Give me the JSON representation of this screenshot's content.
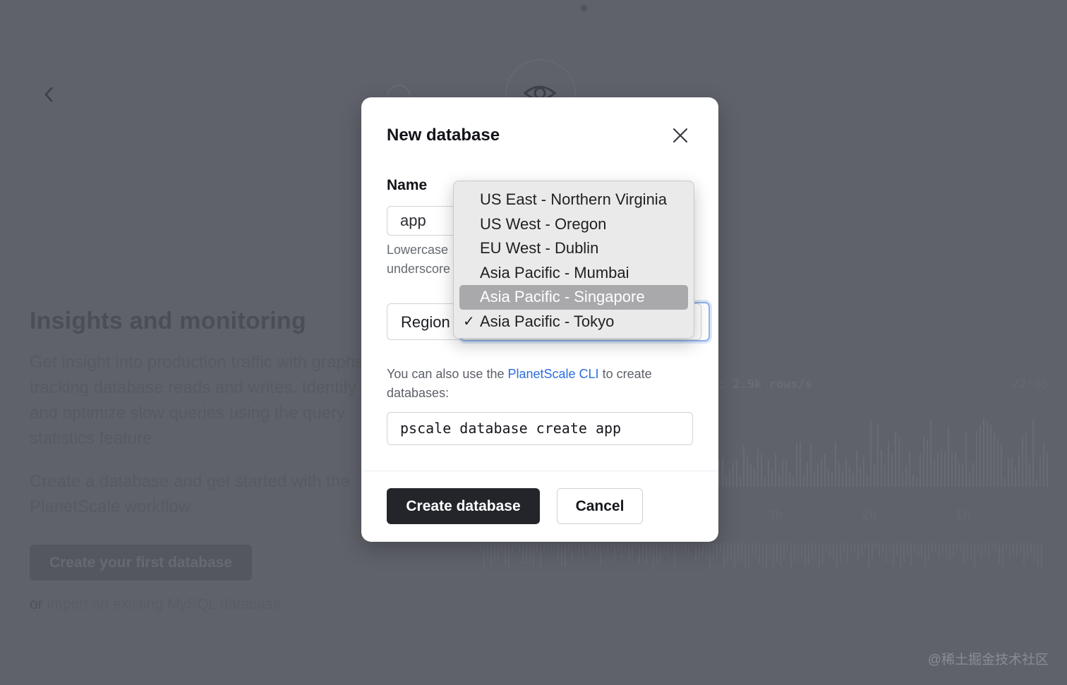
{
  "background": {
    "heading": "Insights and monitoring",
    "description": "Get insight into production traffic with graphs tracking database reads and writes. Identify and optimize slow queries using the query statistics feature.",
    "description2": "Create a database and get started with the PlanetScale workflow.",
    "cta_label": "Create your first database",
    "import_prefix": "or",
    "import_link": "import an existing MySQL database",
    "rows_rate": ": 2.9k rows/s",
    "clock": "22:05",
    "axis_labels": [
      "3h",
      "2h",
      "1h"
    ],
    "watermark": "@稀土掘金技术社区",
    "icons": [
      "back-chevron-icon",
      "eye-icon"
    ]
  },
  "modal": {
    "title": "New database",
    "name_label": "Name",
    "name_value": "app",
    "name_hint_1": "Lowercase",
    "name_hint_2": "underscore",
    "region_label": "Region",
    "cli_prefix": "You can also use the",
    "cli_link": "PlanetScale CLI",
    "cli_suffix": "to create databases:",
    "cli_command": "pscale database create app",
    "primary_button": "Create database",
    "secondary_button": "Cancel",
    "close_icon": "close-icon"
  },
  "region_menu": {
    "options": [
      "US East - Northern Virginia",
      "US West - Oregon",
      "EU West - Dublin",
      "Asia Pacific - Mumbai",
      "Asia Pacific - Singapore",
      "Asia Pacific - Tokyo"
    ],
    "highlighted": "Asia Pacific - Singapore",
    "selected": "Asia Pacific - Tokyo",
    "check_glyph": "✓"
  },
  "colors": {
    "overlay": "#60626b",
    "primary_button": "#23252b",
    "link": "#2a6de0",
    "menu_highlight": "#a9a8ab"
  }
}
